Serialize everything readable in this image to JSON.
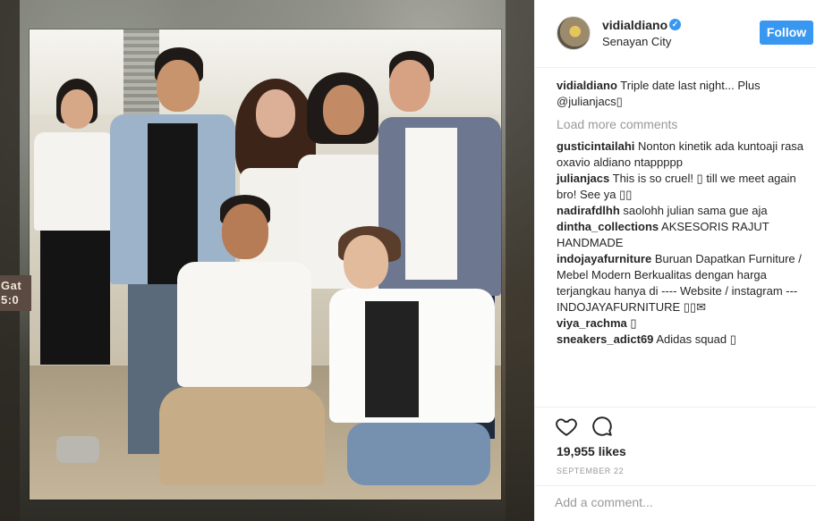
{
  "post": {
    "author": "vidialdiano",
    "location": "Senayan City",
    "follow_label": "Follow",
    "verified_glyph": "✓",
    "sign_text_1": "Gat",
    "sign_text_2": "5:0"
  },
  "caption": {
    "user": "vidialdiano",
    "text": "Triple date last night... Plus @julianjacs▯"
  },
  "load_more": "Load more comments",
  "comments": [
    {
      "user": "gusticintailahi",
      "text": "Nonton kinetik ada kuntoaji rasa oxavio aldiano ntappppp"
    },
    {
      "user": "julianjacs",
      "text": "This is so cruel! ▯ till we meet again bro! See ya ▯▯"
    },
    {
      "user": "nadirafdlhh",
      "text": "saolohh julian sama gue aja"
    },
    {
      "user": "dintha_collections",
      "text": "AKSESORIS RAJUT HANDMADE"
    },
    {
      "user": "indojayafurniture",
      "text": "Buruan Dapatkan Furniture / Mebel Modern Berkualitas dengan harga terjangkau hanya di ---- Website / instagram --- INDOJAYAFURNITURE ▯▯✉"
    },
    {
      "user": "viya_rachma",
      "text": "▯"
    },
    {
      "user": "sneakers_adict69",
      "text": "Adidas squad ▯"
    }
  ],
  "stats": {
    "likes": "19,955 likes",
    "date": "SEPTEMBER 22"
  },
  "comment_input": {
    "placeholder": "Add a comment..."
  },
  "colors": {
    "accent": "#3897f0",
    "muted": "#999999",
    "text": "#262626"
  },
  "icons": {
    "like": "heart-outline-icon",
    "comment": "speech-bubble-icon",
    "verified": "verified-badge-icon"
  }
}
